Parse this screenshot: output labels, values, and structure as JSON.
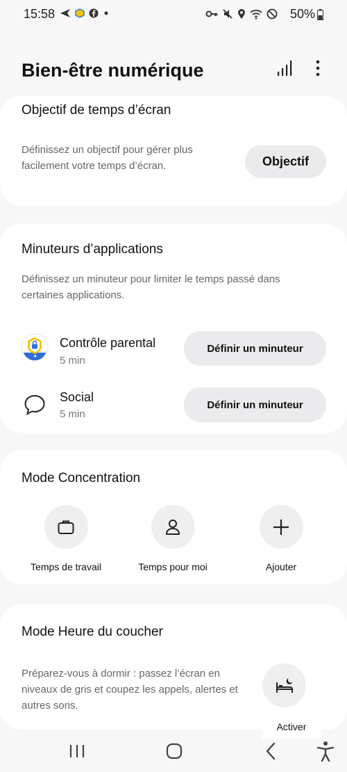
{
  "status_bar": {
    "time": "15:58",
    "battery": "50%"
  },
  "header": {
    "title": "Bien-être numérique"
  },
  "screen_time_goal": {
    "title": "Objectif de temps d’écran",
    "description": "Définissez un objectif pour gérer plus facilement votre temps d’écran.",
    "button_label": "Objectif"
  },
  "app_timers": {
    "title": "Minuteurs d’applications",
    "description": "Définissez un minuteur pour limiter le temps passé dans certaines applications.",
    "apps": [
      {
        "name": "Contrôle parental",
        "time": "5 min",
        "button_label": "Définir un minuteur",
        "icon": "parental-control-icon"
      },
      {
        "name": "Social",
        "time": "5 min",
        "button_label": "Définir un minuteur",
        "icon": "chat-bubble-icon"
      }
    ]
  },
  "focus_mode": {
    "title": "Mode Concentration",
    "modes": [
      {
        "label": "Temps de travail",
        "icon": "briefcase-icon"
      },
      {
        "label": "Temps pour moi",
        "icon": "person-icon"
      },
      {
        "label": "Ajouter",
        "icon": "plus-icon"
      }
    ]
  },
  "bedtime_mode": {
    "title": "Mode Heure du coucher",
    "description": "Préparez-vous à dormir : passez l’écran en niveaux de gris et coupez les appels, alertes et autres sons.",
    "button_label": "Activer"
  },
  "colors": {
    "background": "#f7f7f7",
    "card": "#ffffff",
    "pill": "#ebebed",
    "muted_text": "#666666"
  }
}
